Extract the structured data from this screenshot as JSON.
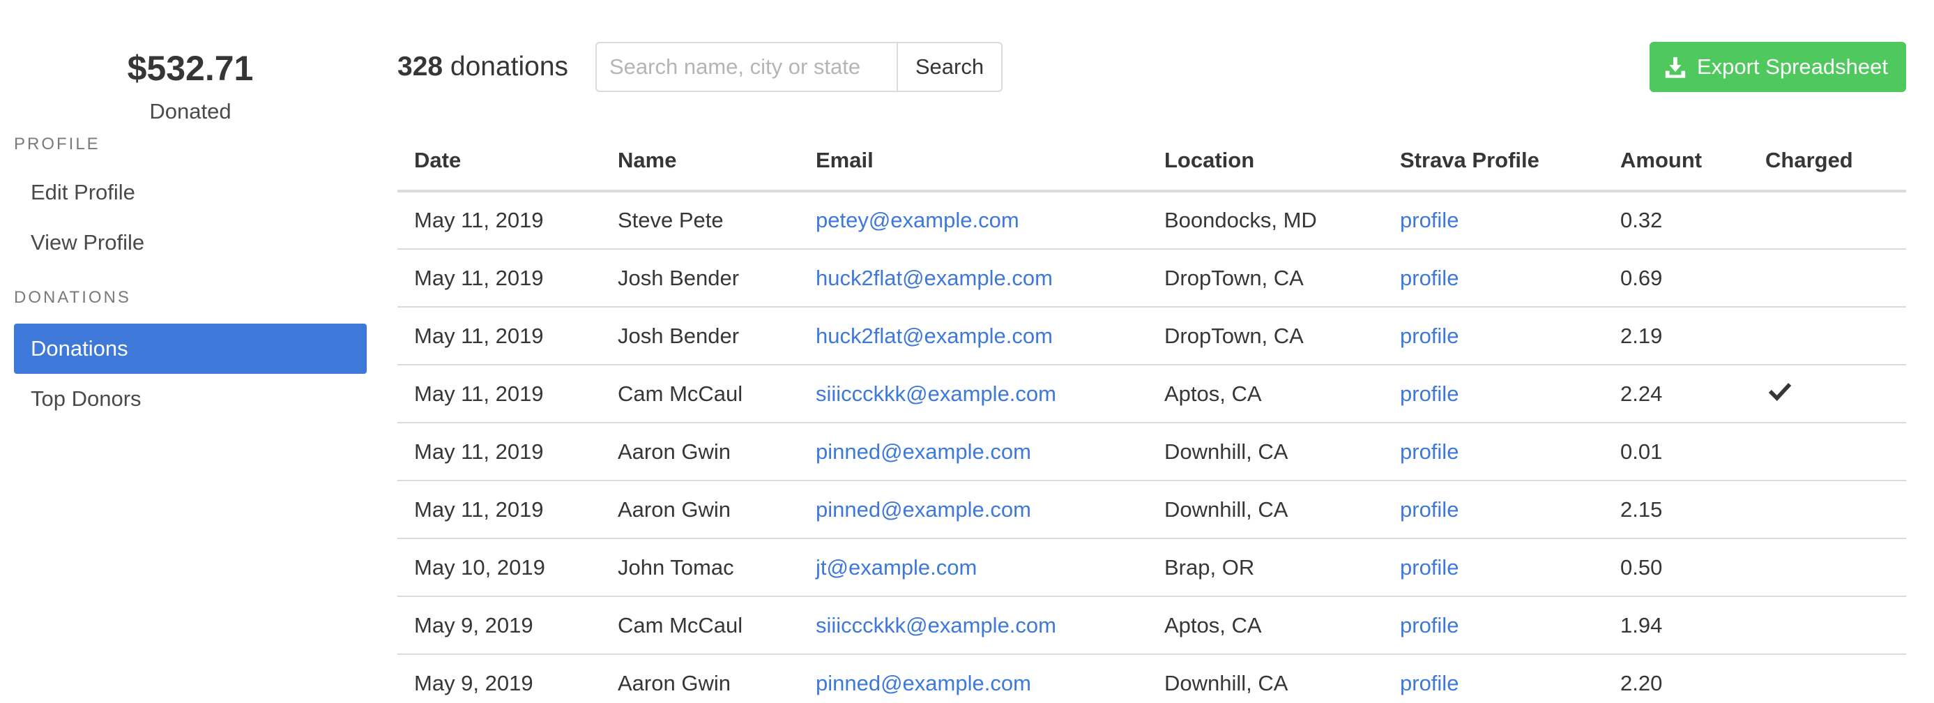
{
  "sidebar": {
    "total": "$532.71",
    "total_label": "Donated",
    "sections": [
      {
        "label": "PROFILE",
        "items": [
          {
            "label": "Edit Profile",
            "active": false
          },
          {
            "label": "View Profile",
            "active": false
          }
        ]
      },
      {
        "label": "DONATIONS",
        "items": [
          {
            "label": "Donations",
            "active": true
          },
          {
            "label": "Top Donors",
            "active": false
          }
        ]
      }
    ]
  },
  "toolbar": {
    "count_number": "328",
    "count_suffix": " donations",
    "search_placeholder": "Search name, city or state",
    "search_value": "",
    "search_label": "Search",
    "export_label": "Export Spreadsheet",
    "export_icon": "download-icon"
  },
  "table": {
    "columns": [
      "Date",
      "Name",
      "Email",
      "Location",
      "Strava Profile",
      "Amount",
      "Charged"
    ],
    "rows": [
      {
        "date": "May 11, 2019",
        "name": "Steve Pete",
        "email": "petey@example.com",
        "location": "Boondocks, MD",
        "strava": "profile",
        "amount": "0.32",
        "charged": false
      },
      {
        "date": "May 11, 2019",
        "name": "Josh Bender",
        "email": "huck2flat@example.com",
        "location": "DropTown, CA",
        "strava": "profile",
        "amount": "0.69",
        "charged": false
      },
      {
        "date": "May 11, 2019",
        "name": "Josh Bender",
        "email": "huck2flat@example.com",
        "location": "DropTown, CA",
        "strava": "profile",
        "amount": "2.19",
        "charged": false
      },
      {
        "date": "May 11, 2019",
        "name": "Cam McCaul",
        "email": "siiiccckkk@example.com",
        "location": "Aptos, CA",
        "strava": "profile",
        "amount": "2.24",
        "charged": true
      },
      {
        "date": "May 11, 2019",
        "name": "Aaron Gwin",
        "email": "pinned@example.com",
        "location": "Downhill, CA",
        "strava": "profile",
        "amount": "0.01",
        "charged": false
      },
      {
        "date": "May 11, 2019",
        "name": "Aaron Gwin",
        "email": "pinned@example.com",
        "location": "Downhill, CA",
        "strava": "profile",
        "amount": "2.15",
        "charged": false
      },
      {
        "date": "May 10, 2019",
        "name": "John Tomac",
        "email": "jt@example.com",
        "location": "Brap, OR",
        "strava": "profile",
        "amount": "0.50",
        "charged": false
      },
      {
        "date": "May 9, 2019",
        "name": "Cam McCaul",
        "email": "siiiccckkk@example.com",
        "location": "Aptos, CA",
        "strava": "profile",
        "amount": "1.94",
        "charged": false
      },
      {
        "date": "May 9, 2019",
        "name": "Aaron Gwin",
        "email": "pinned@example.com",
        "location": "Downhill, CA",
        "strava": "profile",
        "amount": "2.20",
        "charged": false
      }
    ]
  },
  "colors": {
    "accent": "#3e79da",
    "export": "#4fc95d",
    "text": "#363636",
    "border": "#dbdbdb"
  }
}
